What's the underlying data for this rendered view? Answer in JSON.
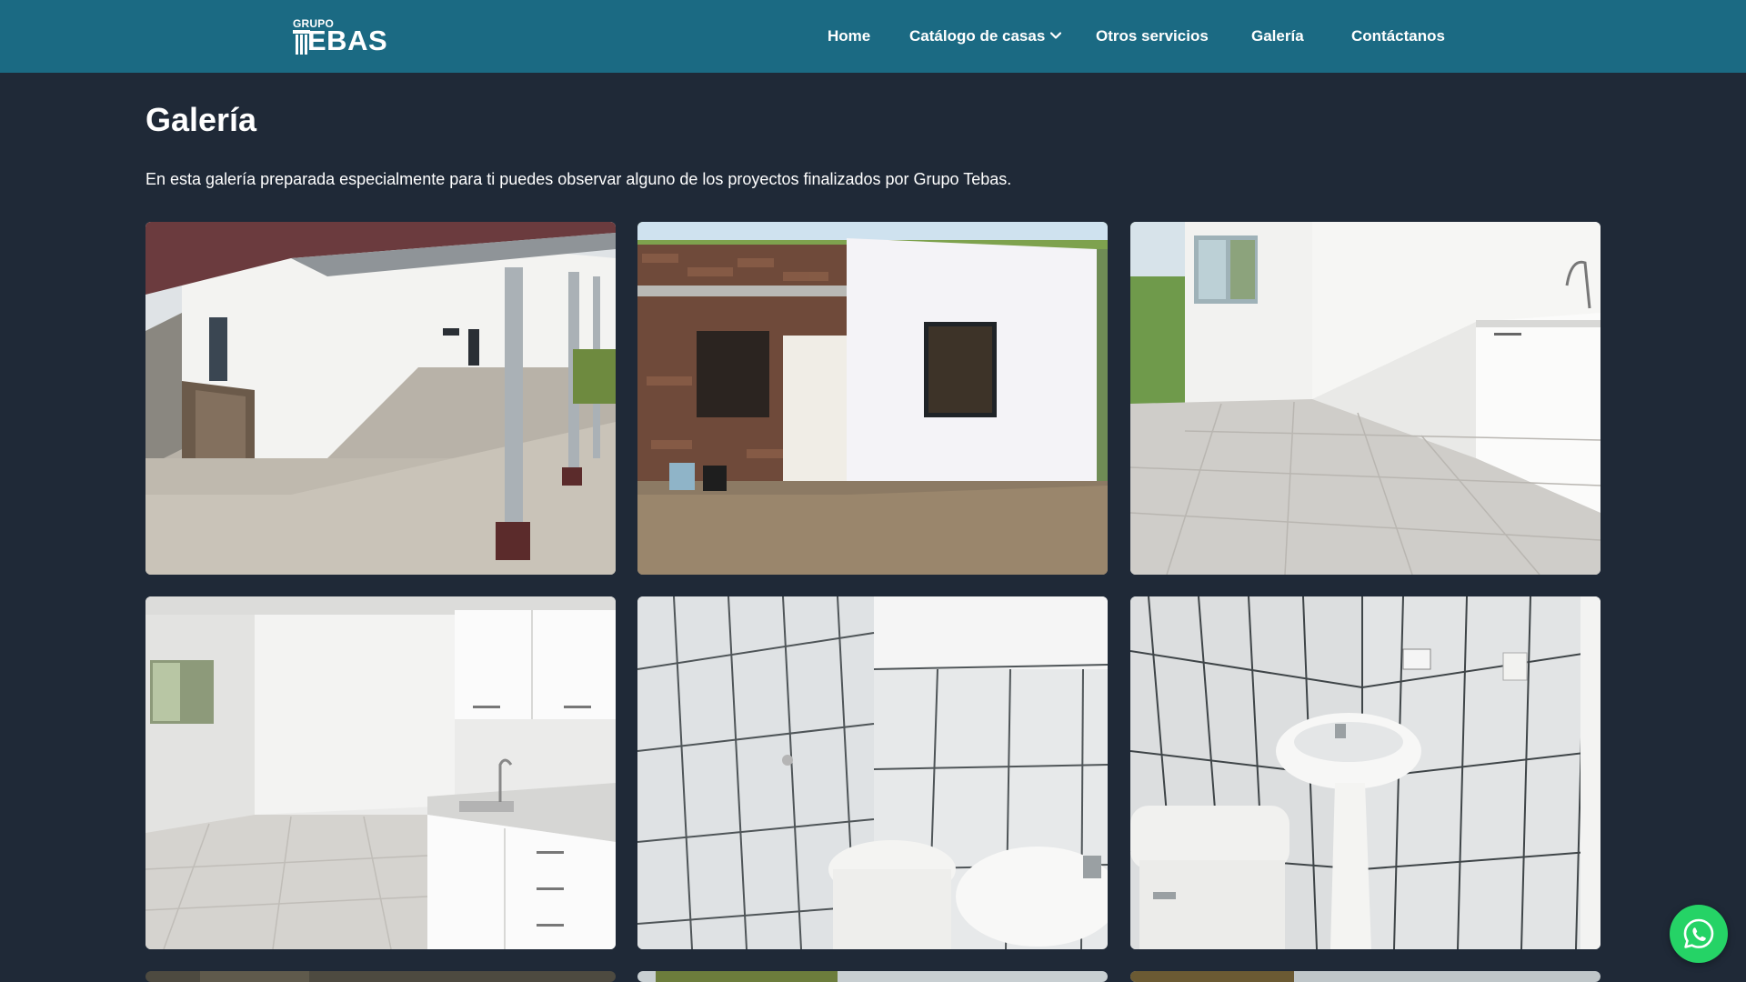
{
  "brand": {
    "logo_small": "GRUPO",
    "logo_big": "EBAS"
  },
  "nav": {
    "items": [
      {
        "label": "Home"
      },
      {
        "label": "Catálogo de casas"
      },
      {
        "label": "Otros servicios"
      },
      {
        "label": "Galería"
      },
      {
        "label": "Contáctanos"
      }
    ]
  },
  "page": {
    "title": "Galería",
    "intro": "En esta galería preparada especialmente para ti puedes observar alguno de los proyectos finalizados por Grupo Tebas."
  },
  "gallery": {
    "photos": [
      {
        "subject": "exterior-covered-porch"
      },
      {
        "subject": "exterior-facade-stone"
      },
      {
        "subject": "interior-tiled-room"
      },
      {
        "subject": "interior-kitchen"
      },
      {
        "subject": "bathroom-tiled-wall"
      },
      {
        "subject": "bathroom-sink-toilet"
      }
    ]
  },
  "floating": {
    "icon": "whatsapp-icon",
    "color": "#25d366"
  },
  "colors": {
    "header": "#1b6a83",
    "background": "#1f2937",
    "text": "#ffffff"
  }
}
